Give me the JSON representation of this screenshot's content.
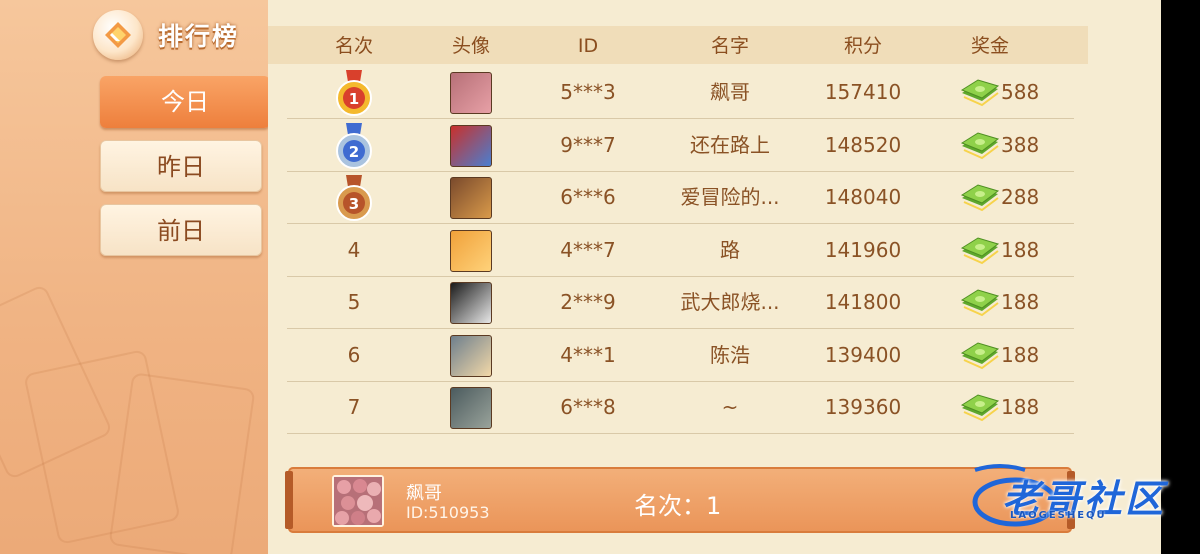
{
  "header": {
    "title": "排行榜",
    "logo_icon": "diamond-logo-icon"
  },
  "tabs": [
    {
      "label": "今日",
      "active": true
    },
    {
      "label": "昨日",
      "active": false
    },
    {
      "label": "前日",
      "active": false
    }
  ],
  "table": {
    "columns": [
      "名次",
      "头像",
      "ID",
      "名字",
      "积分",
      "奖金"
    ],
    "rows": [
      {
        "rank": "1",
        "medal": "gold",
        "id": "5***3",
        "name": "飙哥",
        "score": "157410",
        "prize": "588"
      },
      {
        "rank": "2",
        "medal": "silver",
        "id": "9***7",
        "name": "还在路上",
        "score": "148520",
        "prize": "388"
      },
      {
        "rank": "3",
        "medal": "bronze",
        "id": "6***6",
        "name": "爱冒险的...",
        "score": "148040",
        "prize": "288"
      },
      {
        "rank": "4",
        "medal": "",
        "id": "4***7",
        "name": "路",
        "score": "141960",
        "prize": "188"
      },
      {
        "rank": "5",
        "medal": "",
        "id": "2***9",
        "name": "武大郎烧...",
        "score": "141800",
        "prize": "188"
      },
      {
        "rank": "6",
        "medal": "",
        "id": "4***1",
        "name": "陈浩",
        "score": "139400",
        "prize": "188"
      },
      {
        "rank": "7",
        "medal": "",
        "id": "6***8",
        "name": "~",
        "score": "139360",
        "prize": "188"
      }
    ]
  },
  "footer": {
    "name": "飙哥",
    "id_text": "ID:510953",
    "rank_text": "名次：1"
  },
  "watermark": {
    "text": "老哥社区",
    "subtext": "LAOGESHEQU"
  },
  "colors": {
    "accent": "#ee7f3c",
    "panel": "#f6ecd2",
    "text": "#8a5225",
    "money": "#7cc63a"
  }
}
